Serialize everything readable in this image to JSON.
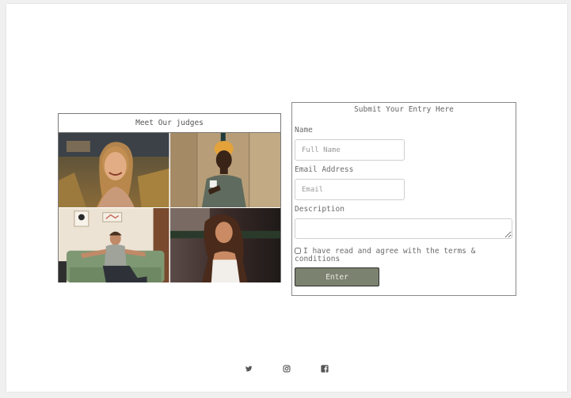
{
  "judges": {
    "title": "Meet Our judges",
    "photos": [
      {
        "icon": "portrait-woman-smiling-field"
      },
      {
        "icon": "portrait-woman-headwrap-cup"
      },
      {
        "icon": "portrait-man-sitting-couch"
      },
      {
        "icon": "portrait-woman-long-hair-dusk"
      }
    ]
  },
  "form": {
    "title": "Submit Your Entry Here",
    "name_label": "Name",
    "name_placeholder": "Full Name",
    "email_label": "Email Address",
    "email_placeholder": "Email",
    "description_label": "Description",
    "terms_text": "I have read and agree with the terms & conditions",
    "submit_label": "Enter"
  },
  "footer": {
    "social": [
      {
        "icon": "twitter-icon"
      },
      {
        "icon": "instagram-icon"
      },
      {
        "icon": "facebook-icon"
      }
    ]
  },
  "colors": {
    "button_bg": "#7b8270",
    "icon_color": "#555555",
    "border": "#7a7a7a"
  }
}
